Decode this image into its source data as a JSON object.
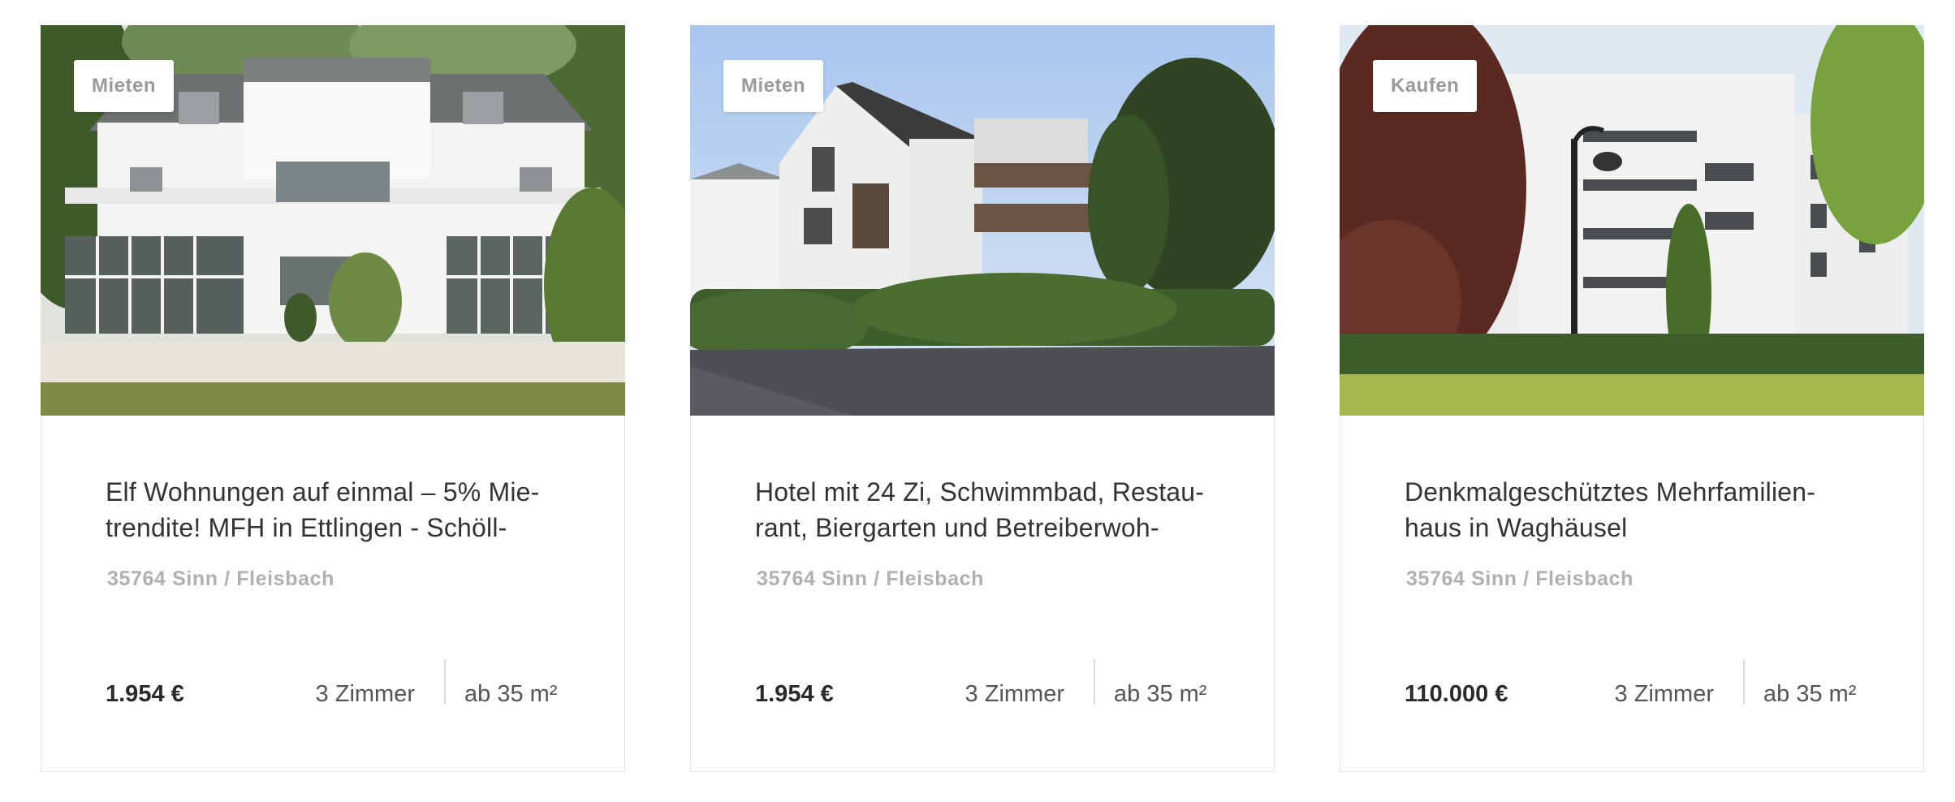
{
  "listings": [
    {
      "badge": "Mieten",
      "title": "Elf Wohnungen auf einmal – 5% Mie-\ntrendite! MFH in Ettlingen - Schöll-",
      "location": "35764 Sinn / Fleisbach",
      "price": "1.954 €",
      "rooms": "3 Zimmer",
      "area": "ab 35 m²",
      "photo_icon": "white-villa-photo"
    },
    {
      "badge": "Mieten",
      "title": "Hotel mit 24 Zi, Schwimmbad, Restau-\nrant, Biergarten und Betreiberwoh-",
      "location": "35764 Sinn / Fleisbach",
      "price": "1.954 €",
      "rooms": "3 Zimmer",
      "area": "ab 35 m²",
      "photo_icon": "modern-house-photo"
    },
    {
      "badge": "Kaufen",
      "title": "Denkmalgeschütztes Mehrfamilien-\nhaus in Waghäusel",
      "location": "35764 Sinn / Fleisbach",
      "price": "110.000 €",
      "rooms": "3 Zimmer",
      "area": "ab 35 m²",
      "photo_icon": "apartment-block-photo"
    }
  ],
  "colors": {
    "badge_text": "#9a9a9a",
    "title_text": "#333333",
    "location_text": "#b0b0b0",
    "price_text": "#2a2a2a",
    "card_border": "#e3e3e3"
  }
}
